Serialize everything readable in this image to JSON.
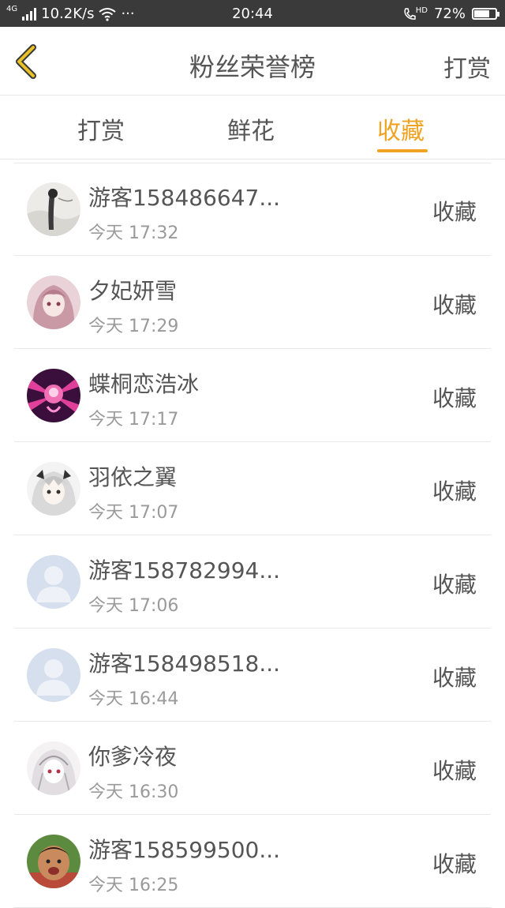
{
  "status_bar": {
    "network": "4G",
    "speed": "10.2K/s",
    "more": "···",
    "time": "20:44",
    "hd": "HD",
    "battery_text": "72%",
    "battery_level": 0.72
  },
  "header": {
    "title": "粉丝荣誉榜",
    "right_action": "打赏"
  },
  "tabs": [
    {
      "label": "打赏",
      "active": false
    },
    {
      "label": "鲜花",
      "active": false
    },
    {
      "label": "收藏",
      "active": true
    }
  ],
  "accent_color": "#f0a322",
  "rows": [
    {
      "name": "游客158486647...",
      "time": "今天 17:32",
      "action": "收藏",
      "avatar": "ink-art"
    },
    {
      "name": "夕妃妍雪",
      "time": "今天 17:29",
      "action": "收藏",
      "avatar": "anime-pink"
    },
    {
      "name": "蝶桐恋浩冰",
      "time": "今天 17:17",
      "action": "收藏",
      "avatar": "neon-magenta"
    },
    {
      "name": "羽依之翼",
      "time": "今天 17:07",
      "action": "收藏",
      "avatar": "anime-white-hair"
    },
    {
      "name": "游客158782994...",
      "time": "今天 17:06",
      "action": "收藏",
      "avatar": "default-user"
    },
    {
      "name": "游客158498518...",
      "time": "今天 16:44",
      "action": "收藏",
      "avatar": "default-user"
    },
    {
      "name": "你爹冷夜",
      "time": "今天 16:30",
      "action": "收藏",
      "avatar": "anime-sketch"
    },
    {
      "name": "游客158599500...",
      "time": "今天 16:25",
      "action": "收藏",
      "avatar": "child-photo"
    }
  ]
}
